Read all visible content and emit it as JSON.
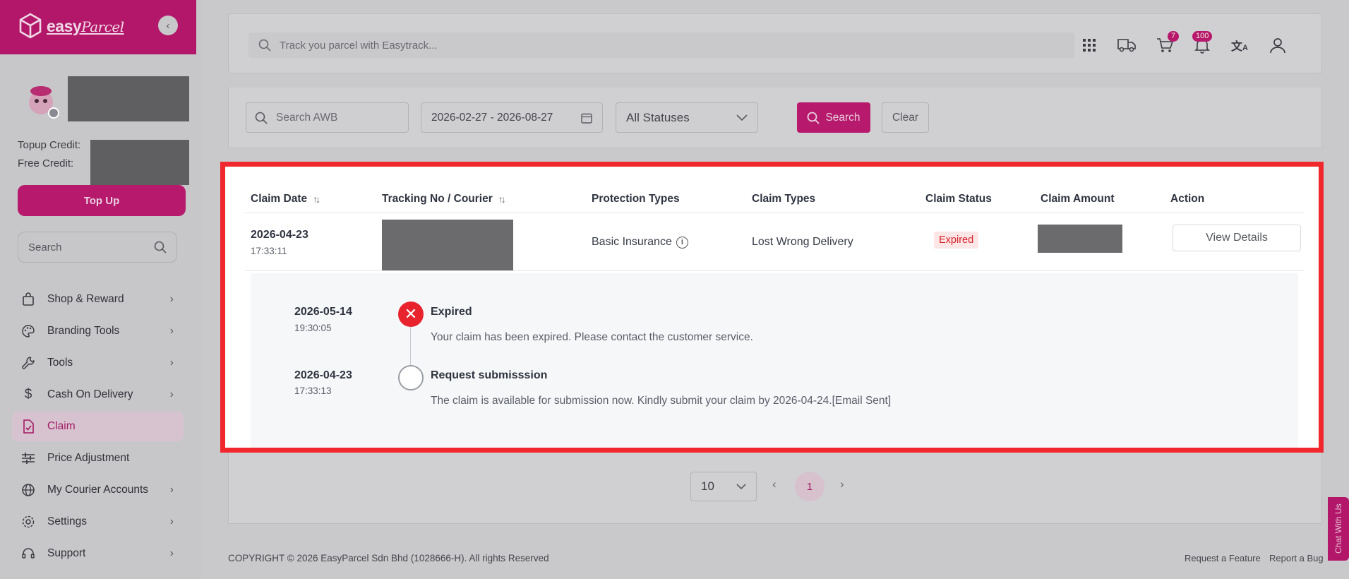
{
  "brand": {
    "name": "easy",
    "script": "Parcel",
    "color": "#b3176a"
  },
  "sidebar": {
    "topup_credit_label": "Topup Credit:",
    "free_credit_label": "Free Credit:",
    "topup_button": "Top Up",
    "search_placeholder": "Search",
    "items": [
      {
        "label": "Shop & Reward",
        "icon": "shopping-bag-icon",
        "has_children": true
      },
      {
        "label": "Branding Tools",
        "icon": "palette-icon",
        "has_children": true
      },
      {
        "label": "Tools",
        "icon": "wrench-icon",
        "has_children": true
      },
      {
        "label": "Cash On Delivery",
        "icon": "dollar-icon",
        "has_children": true
      },
      {
        "label": "Claim",
        "icon": "claim-document-icon",
        "has_children": false,
        "active": true
      },
      {
        "label": "Price Adjustment",
        "icon": "sliders-icon",
        "has_children": false
      },
      {
        "label": "My Courier Accounts",
        "icon": "globe-icon",
        "has_children": true
      },
      {
        "label": "Settings",
        "icon": "gear-icon",
        "has_children": true
      },
      {
        "label": "Support",
        "icon": "headset-icon",
        "has_children": true
      }
    ]
  },
  "topbar": {
    "track_placeholder": "Track you parcel with Easytrack...",
    "cart_count": "7",
    "notification_count": "100"
  },
  "filters": {
    "awb_placeholder": "Search AWB",
    "date_range": "2026-02-27 - 2026-08-27",
    "status_value": "All Statuses",
    "search_button": "Search",
    "clear_button": "Clear"
  },
  "table": {
    "headers": [
      "Claim Date",
      "Tracking No / Courier",
      "Protection Types",
      "Claim Types",
      "Claim Status",
      "Claim Amount",
      "Action"
    ],
    "row": {
      "claim_date": "2026-04-23",
      "claim_time": "17:33:11",
      "protection_type": "Basic Insurance",
      "claim_type": "Lost Wrong Delivery",
      "claim_status": "Expired",
      "action": "View Details"
    },
    "timeline": [
      {
        "date": "2026-05-14",
        "time": "19:30:05",
        "title": "Expired",
        "description": "Your claim has been expired. Please contact the customer service.",
        "state": "failed"
      },
      {
        "date": "2026-04-23",
        "time": "17:33:13",
        "title": "Request submisssion",
        "description": "The claim is available for submission now. Kindly submit your claim by 2026-04-24.[Email Sent]",
        "state": "pending"
      }
    ]
  },
  "pagination": {
    "page_size": "10",
    "current_page": "1"
  },
  "footer": {
    "copyright": "COPYRIGHT © 2026 EasyParcel Sdn Bhd (1028666-H). All rights Reserved",
    "request_feature": "Request a Feature",
    "report_bug": "Report a Bug"
  },
  "chat": {
    "label": "Chat With Us"
  },
  "colors": {
    "accent": "#b71a6c",
    "highlight_border": "#f0282e",
    "expired": "#e8232e"
  }
}
